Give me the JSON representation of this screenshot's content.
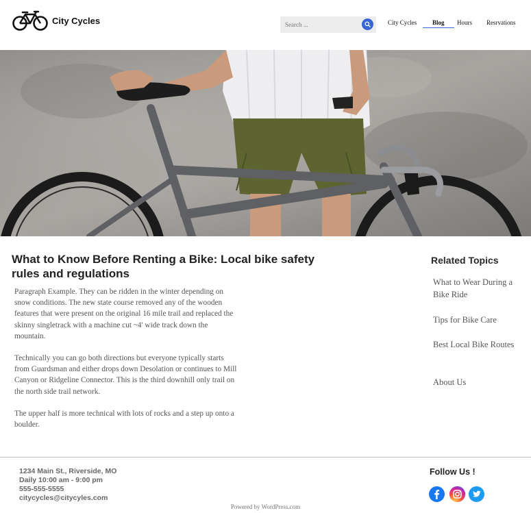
{
  "header": {
    "site_name": "City Cycles",
    "search_placeholder": "Search ...",
    "nav": [
      "City Cycles",
      "Blog",
      "Hours",
      "Resrvations"
    ],
    "active_nav": "Blog",
    "accent_color": "#3866d6"
  },
  "article": {
    "title": "What to Know Before Renting a Bike: Local bike safety rules and regulations",
    "paragraphs": [
      "Paragraph Example. They can be ridden in the winter depending on snow conditions. The new state course removed any of the wooden features that were present on the original 16 mile trail and replaced the skinny singletrack with a machine cut ~4' wide track down the mountain.",
      "Technically you can go both directions but everyone typically starts from Guardsman and either drops down Desolation or continues to Mill Canyon or Ridgeline Connector. This is the third downhill only trail on the north side trail network.",
      "The upper half is more technical with lots of rocks and a step up onto a boulder."
    ]
  },
  "sidebar": {
    "title": "Related Topics",
    "links": [
      "What to Wear During a Bike Ride",
      "Tips for Bike Care",
      "Best Local Bike Routes",
      "About Us"
    ]
  },
  "footer": {
    "address": "1234 Main St., Riverside, MO",
    "hours": "Daily 10:00 am - 9:00 pm",
    "phone": "555-555-5555",
    "email": "citycycles@citycyles.com",
    "follow_title": "Follow Us !",
    "social": [
      "facebook-icon",
      "instagram-icon",
      "twitter-icon"
    ],
    "powered": "Powered by WordPress.com"
  }
}
